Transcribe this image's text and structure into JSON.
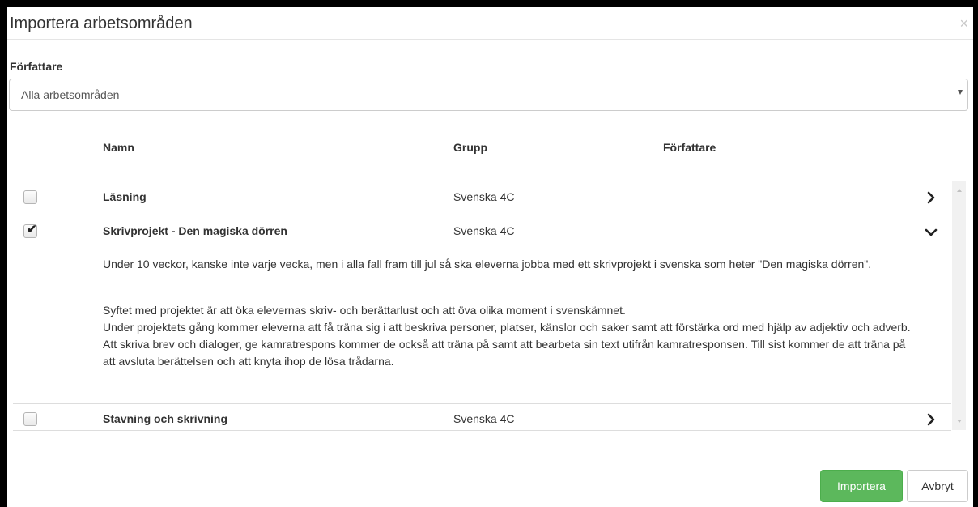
{
  "dialog": {
    "title": "Importera arbetsområden",
    "close_glyph": "×"
  },
  "filter": {
    "label": "Författare",
    "selected": "Alla arbetsområden"
  },
  "table": {
    "headers": {
      "name": "Namn",
      "group": "Grupp",
      "author": "Författare"
    },
    "rows": [
      {
        "checked": false,
        "name": "Läsning",
        "group": "Svenska 4C",
        "expanded": false,
        "chevron_icon": "chevron-right-icon"
      },
      {
        "checked": true,
        "name": "Skrivprojekt - Den magiska dörren",
        "group": "Svenska 4C",
        "expanded": true,
        "chevron_icon": "chevron-down-icon",
        "description_p1": "Under 10 veckor, kanske inte varje vecka, men i alla fall fram till jul så ska eleverna jobba med ett skrivprojekt i svenska som heter \"Den magiska dörren\".",
        "description_p2_line1": "Syftet med projektet är att öka elevernas skriv- och berättarlust och att öva olika moment i svenskämnet.",
        "description_p2_line2": "Under projektets gång kommer eleverna att få träna sig i att beskriva personer, platser, känslor och saker samt att förstärka ord med hjälp av adjektiv och adverb. Att skriva brev och dialoger, ge kamratrespons kommer de också att träna på samt att bearbeta sin text utifrån kamratresponsen. Till sist kommer de att träna på att avsluta berättelsen och att knyta ihop de lösa trådarna."
      },
      {
        "checked": false,
        "name": "Stavning och skrivning",
        "group": "Svenska 4C",
        "expanded": false,
        "chevron_icon": "chevron-right-icon"
      }
    ]
  },
  "footer": {
    "import_label": "Importera",
    "cancel_label": "Avbryt"
  },
  "colors": {
    "import_button": "#5cb85c",
    "checkmark": "#222222",
    "border": "#dddddd"
  }
}
